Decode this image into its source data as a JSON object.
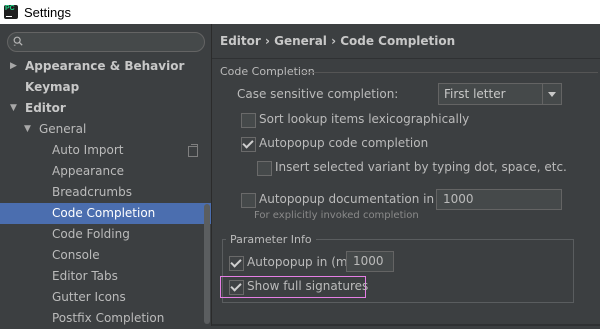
{
  "window": {
    "title": "Settings"
  },
  "search": {
    "placeholder": ""
  },
  "sidebar": {
    "items": [
      {
        "label": "Appearance & Behavior",
        "expanded": false
      },
      {
        "label": "Keymap"
      },
      {
        "label": "Editor",
        "expanded": true
      },
      {
        "label": "General",
        "expanded": true
      },
      {
        "label": "Auto Import"
      },
      {
        "label": "Appearance"
      },
      {
        "label": "Breadcrumbs"
      },
      {
        "label": "Code Completion",
        "selected": true
      },
      {
        "label": "Code Folding"
      },
      {
        "label": "Console"
      },
      {
        "label": "Editor Tabs"
      },
      {
        "label": "Gutter Icons"
      },
      {
        "label": "Postfix Completion"
      }
    ]
  },
  "main": {
    "breadcrumb": "Editor › General › Code Completion",
    "section_title": "Code Completion",
    "case_sensitive": {
      "label": "Case sensitive completion:",
      "value": "First letter"
    },
    "sort_lookup": {
      "label": "Sort lookup items lexicographically",
      "checked": false
    },
    "autopopup_code": {
      "label": "Autopopup code completion",
      "checked": true
    },
    "insert_selected": {
      "label": "Insert selected variant by typing dot, space, etc.",
      "checked": false
    },
    "autopopup_doc": {
      "label": "Autopopup documentation in (ms):",
      "checked": false,
      "value": "1000",
      "hint": "For explicitly invoked completion"
    },
    "parameter_info": {
      "title": "Parameter Info",
      "autopopup": {
        "label": "Autopopup in (ms):",
        "checked": true,
        "value": "1000"
      },
      "show_full_signatures": {
        "label": "Show full signatures",
        "checked": true
      }
    }
  },
  "colors": {
    "background": "#3c3f41",
    "selection": "#4b6eaf",
    "highlight_border": "#e57fe5"
  }
}
